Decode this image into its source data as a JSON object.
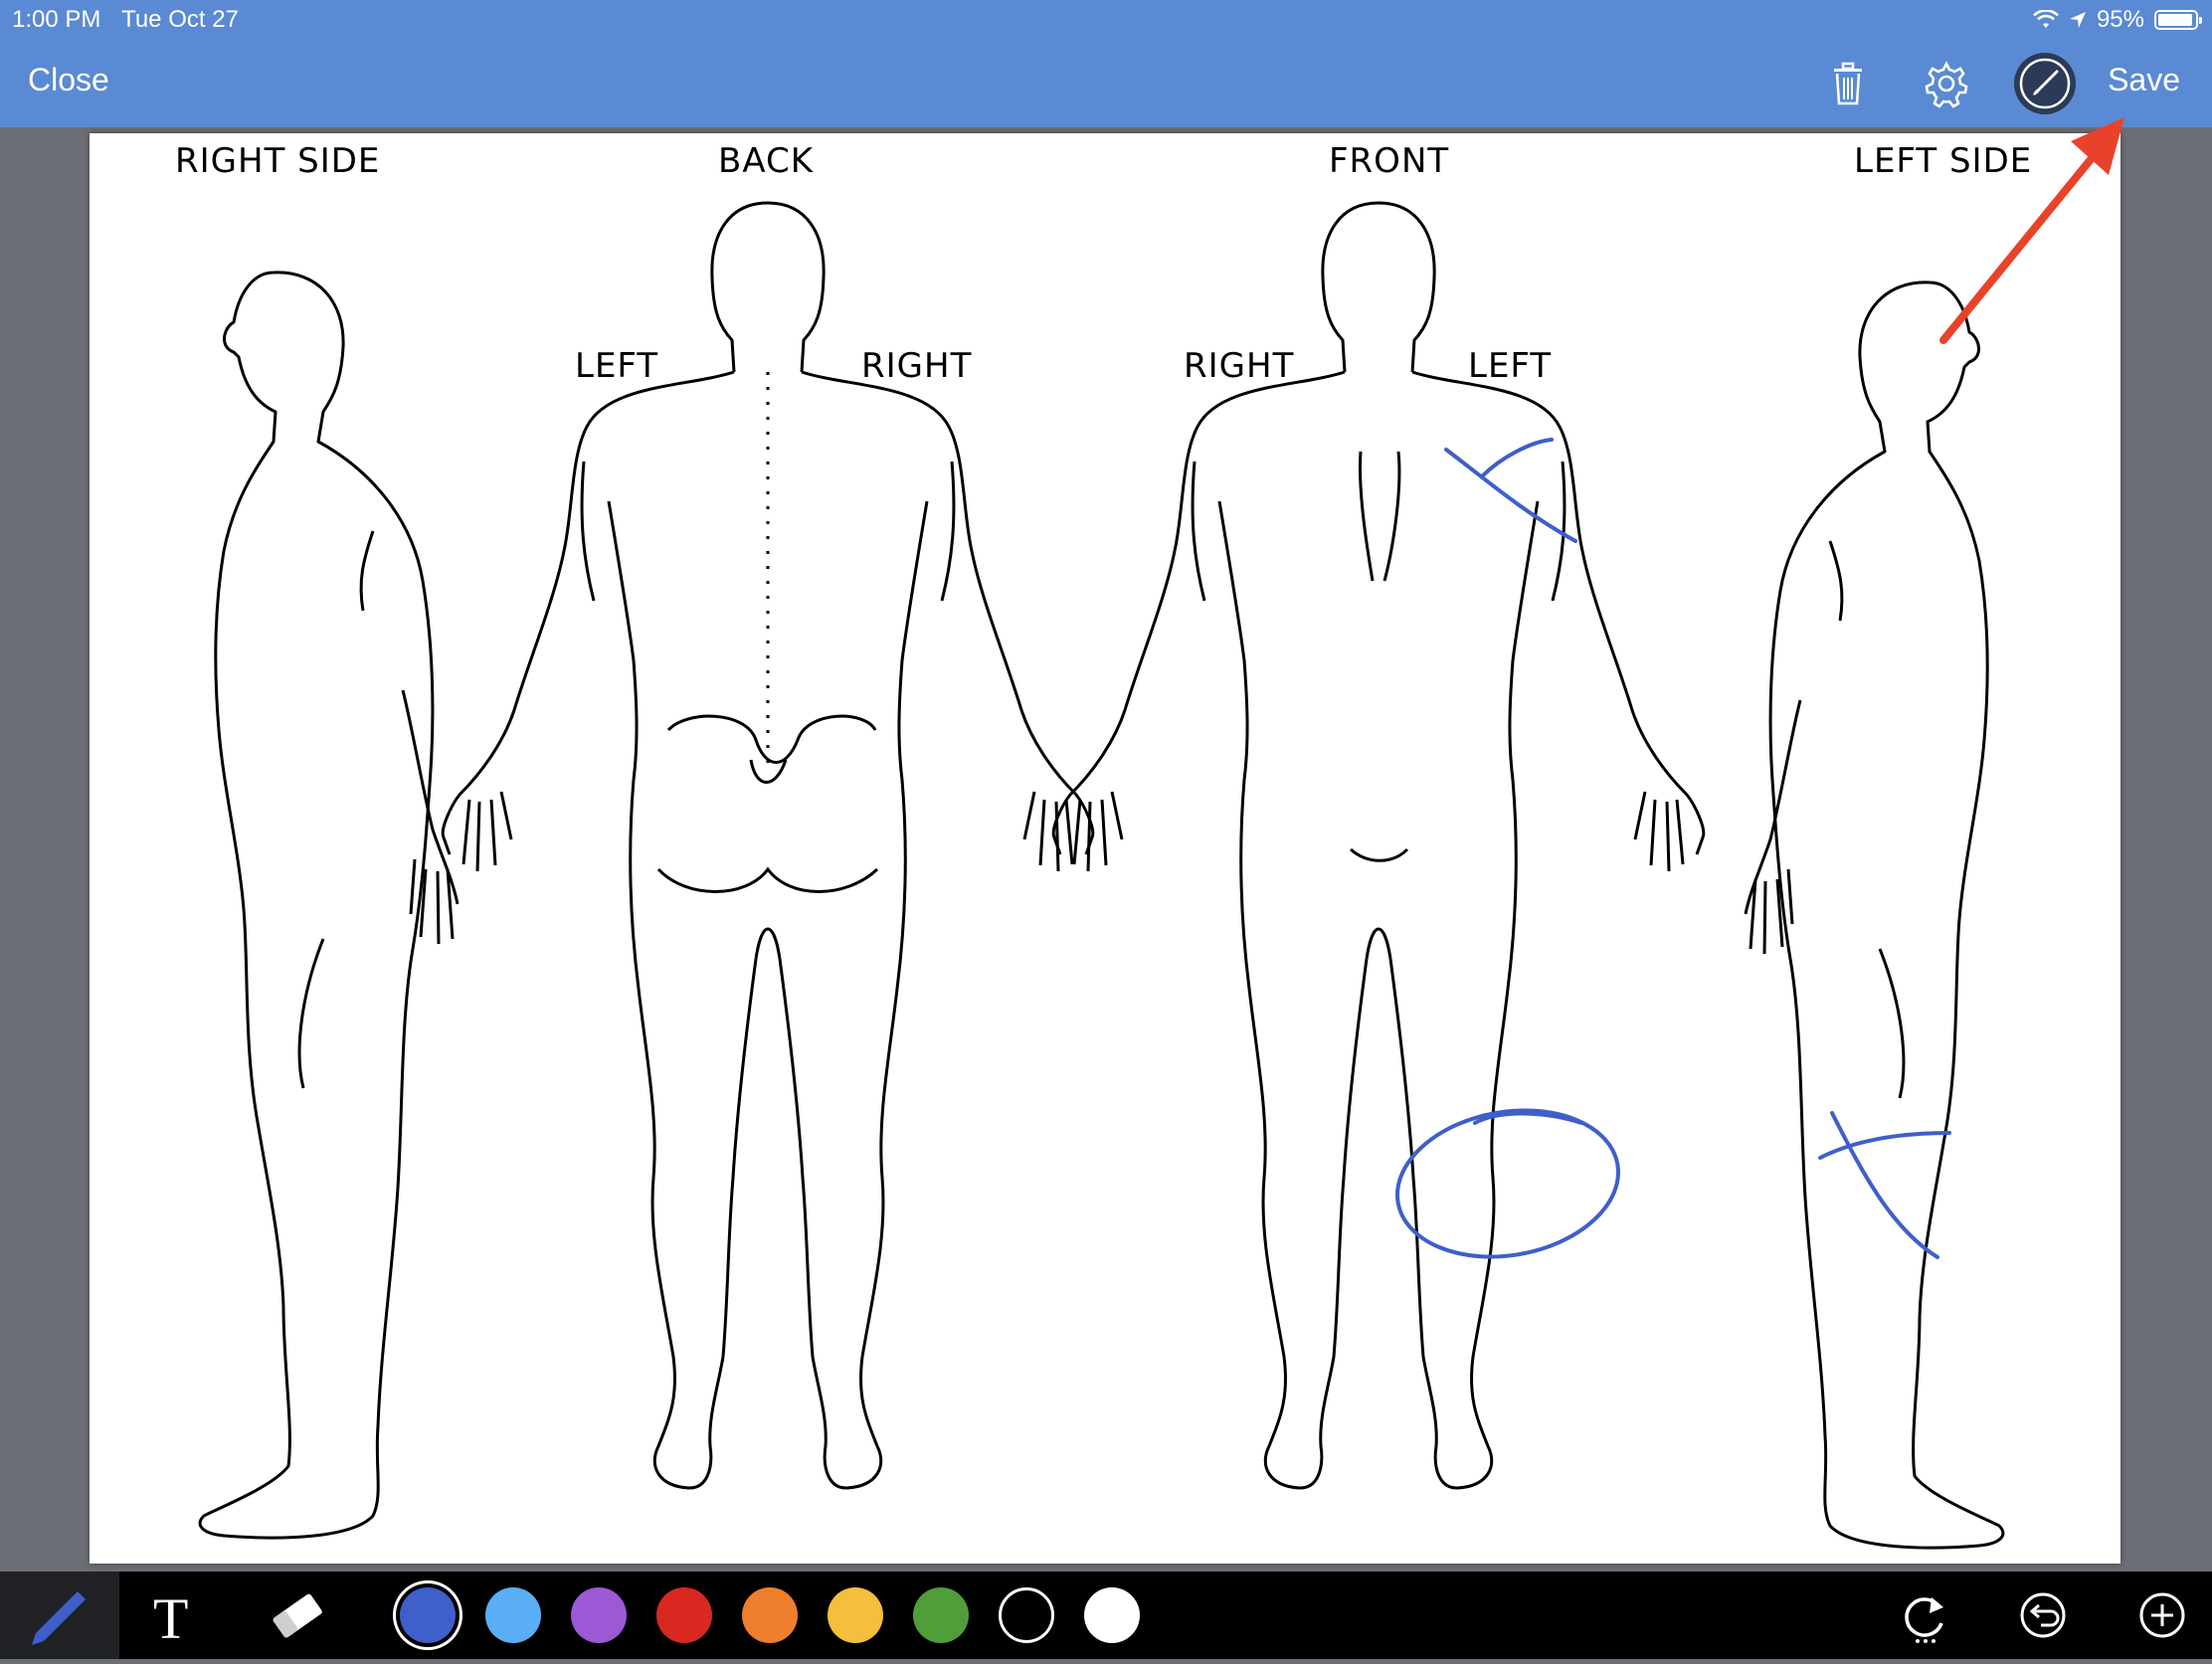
{
  "status": {
    "time": "1:00 PM",
    "date": "Tue Oct 27",
    "battery": "95%",
    "battery_level": 0.95
  },
  "nav": {
    "close_label": "Close",
    "save_label": "Save",
    "icons": [
      "trash-icon",
      "gear-icon",
      "pen-style-icon"
    ]
  },
  "diagram": {
    "labels": {
      "right_side": "RIGHT SIDE",
      "back": "BACK",
      "front": "FRONT",
      "left_side": "LEFT SIDE",
      "back_left": "LEFT",
      "back_right": "RIGHT",
      "front_right": "RIGHT",
      "front_left": "LEFT"
    }
  },
  "annotations": {
    "stroke_color": "#3f5fca",
    "arrow_color": "#e8432a"
  },
  "toolbar": {
    "tools": [
      "pen-icon",
      "text-tool-icon",
      "eraser-icon"
    ],
    "text_tool_glyph": "T",
    "colors": [
      "#3f5fca",
      "#5aaef5",
      "#9b59d6",
      "#d8281f",
      "#ee7f2c",
      "#f5be3d",
      "#4f9e3a",
      "#000000",
      "#ffffff"
    ],
    "selected_color": "#3f5fca",
    "right_tools": [
      "redo-icon",
      "undo-icon",
      "add-icon"
    ]
  }
}
